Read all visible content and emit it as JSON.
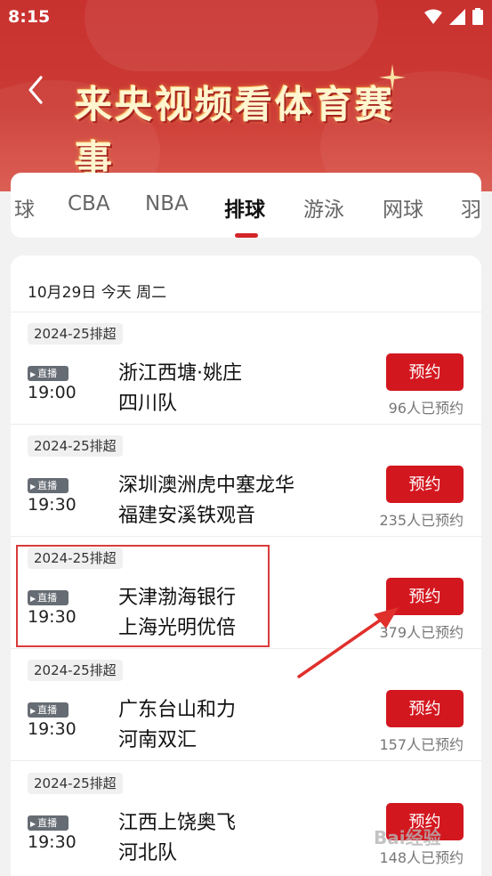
{
  "status_bar": {
    "time": "8:15"
  },
  "header": {
    "title": "来央视频看体育赛事",
    "back_icon": "chevron-left-icon"
  },
  "tabs": [
    {
      "label": "球",
      "active": false
    },
    {
      "label": "CBA",
      "active": false
    },
    {
      "label": "NBA",
      "active": false
    },
    {
      "label": "排球",
      "active": true
    },
    {
      "label": "游泳",
      "active": false
    },
    {
      "label": "网球",
      "active": false
    },
    {
      "label": "羽",
      "active": false
    }
  ],
  "schedule": {
    "date": "10月29日 今天 周二",
    "live_label": "直播",
    "reserve_label": "预约",
    "matches": [
      {
        "league": "2024-25排超",
        "time": "19:00",
        "home": "浙江西塘·姚庄",
        "away": "四川队",
        "reserved": "96人已预约"
      },
      {
        "league": "2024-25排超",
        "time": "19:30",
        "home": "深圳澳洲虎中塞龙华",
        "away": "福建安溪铁观音",
        "reserved": "235人已预约"
      },
      {
        "league": "2024-25排超",
        "time": "19:30",
        "home": "天津渤海银行",
        "away": "上海光明优倍",
        "reserved": "379人已预约"
      },
      {
        "league": "2024-25排超",
        "time": "19:30",
        "home": "广东台山和力",
        "away": "河南双汇",
        "reserved": "157人已预约"
      },
      {
        "league": "2024-25排超",
        "time": "19:30",
        "home": "江西上饶奥飞",
        "away": "河北队",
        "reserved": "148人已预约"
      }
    ]
  },
  "colors": {
    "header_red": "#c8312e",
    "accent_red": "#d3171f",
    "badge_gray": "#666c74"
  },
  "watermark": "Bai经验"
}
